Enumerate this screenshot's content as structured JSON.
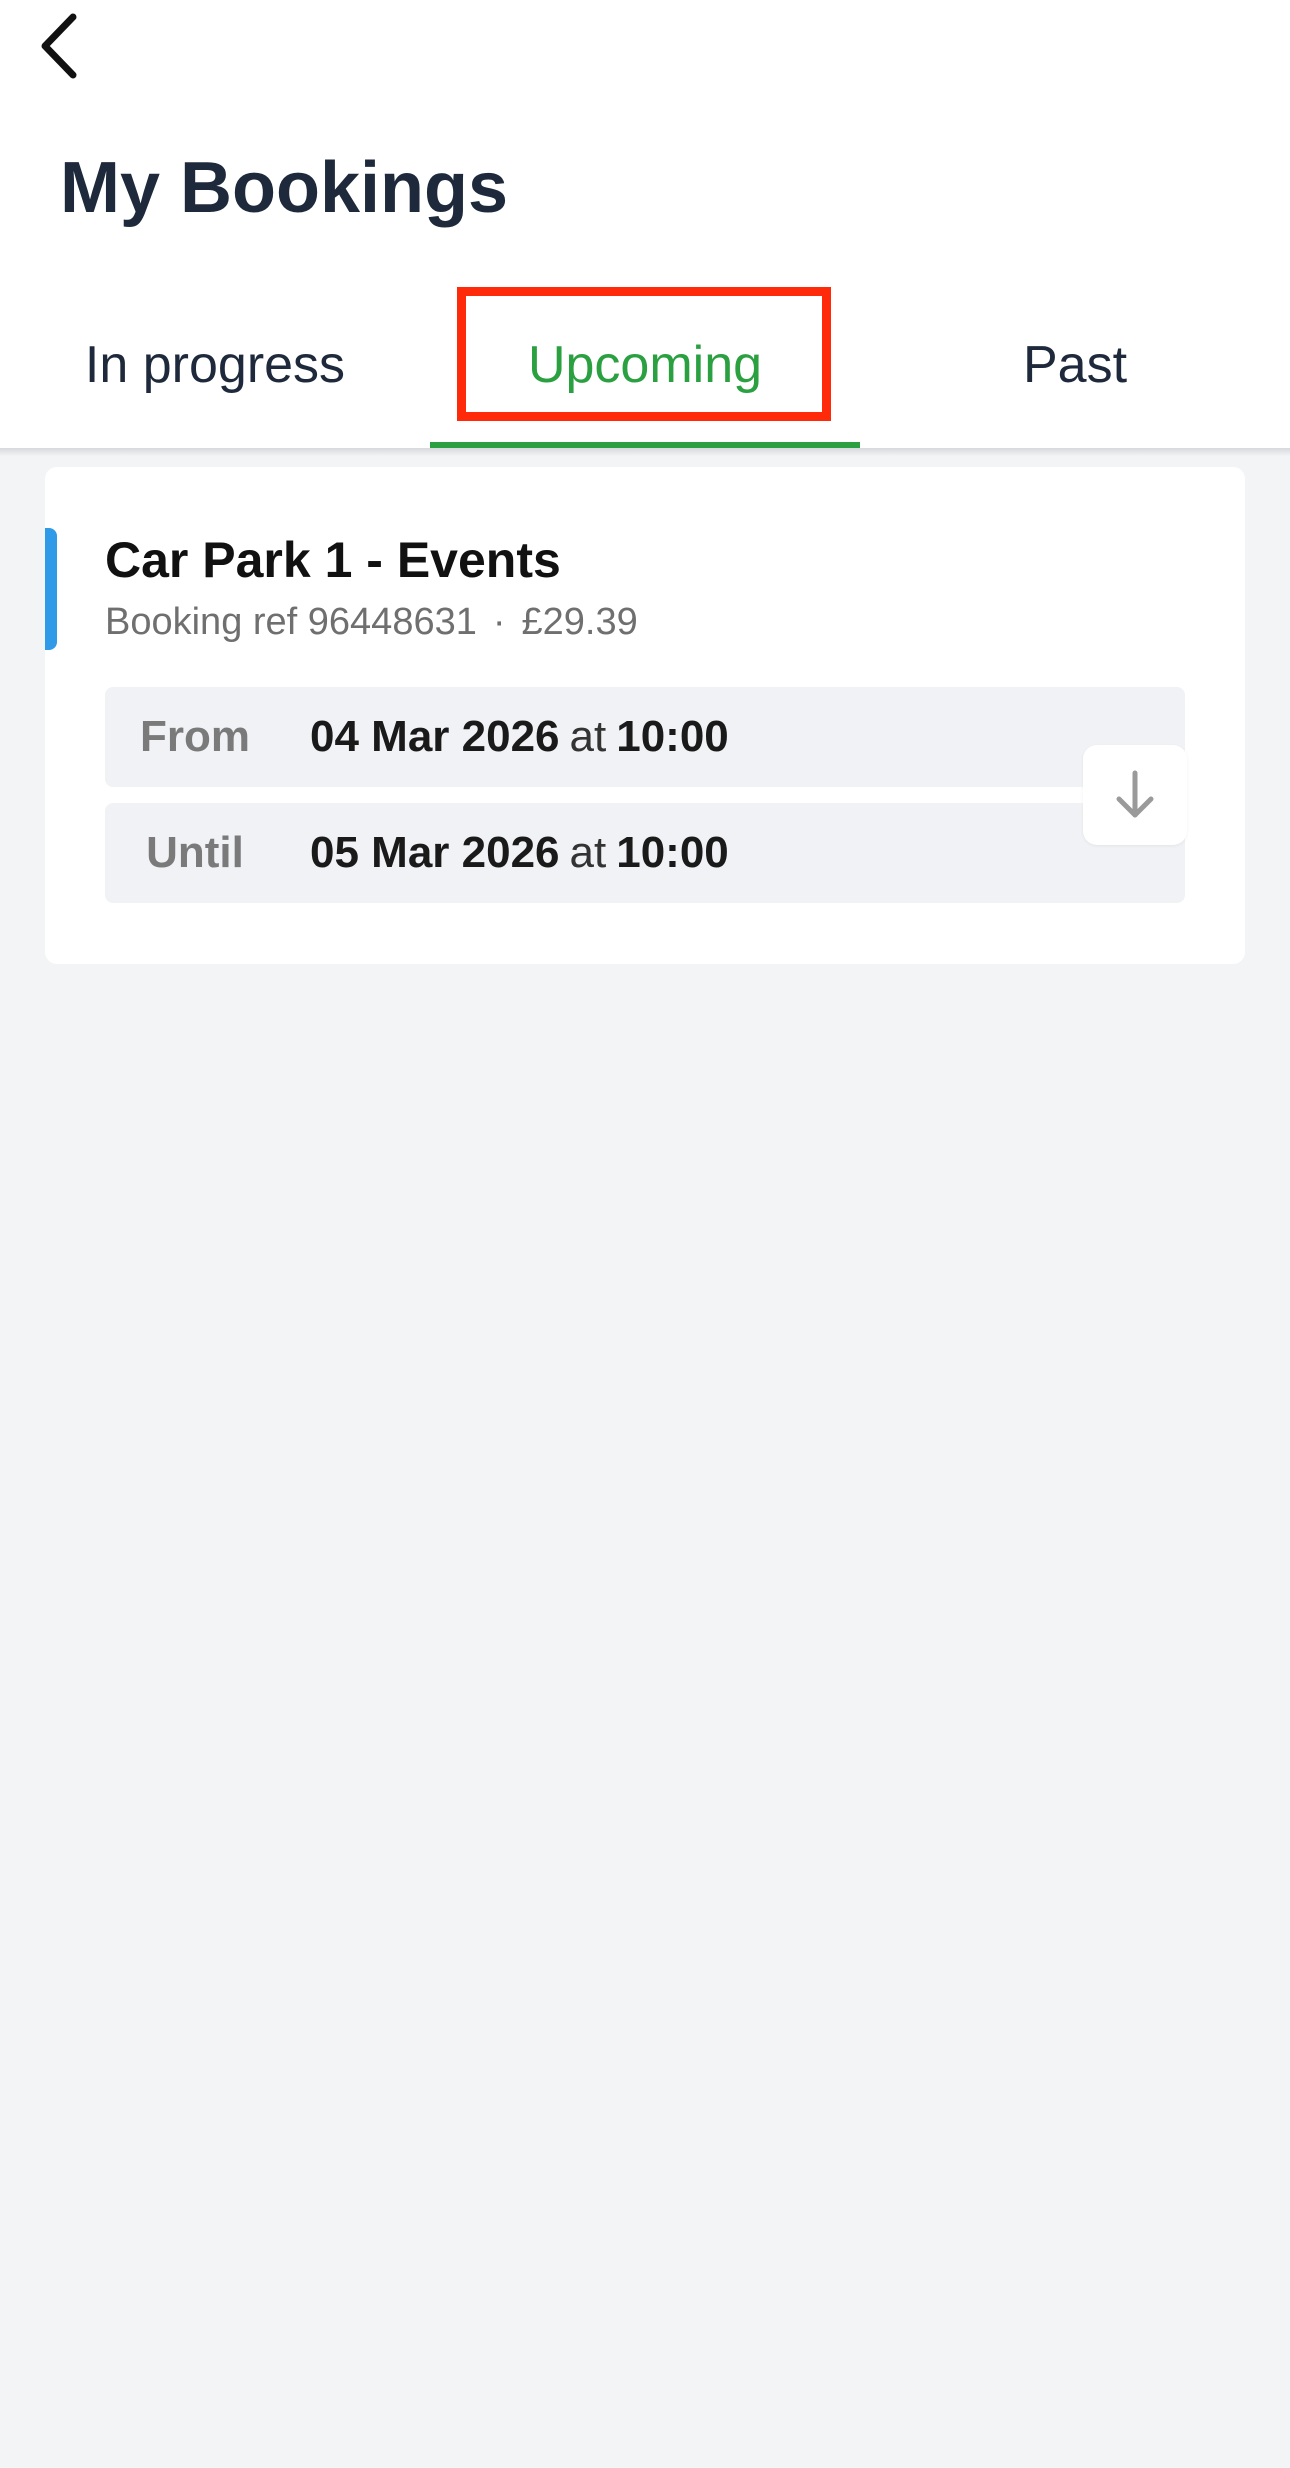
{
  "header": {
    "back_icon": "chevron-left-icon",
    "title": "My Bookings"
  },
  "tabs": [
    {
      "label": "In progress",
      "selected": false
    },
    {
      "label": "Upcoming",
      "selected": true
    },
    {
      "label": "Past",
      "selected": false
    }
  ],
  "colors": {
    "accent_green": "#2aa040",
    "highlight_red": "#ff2a0a",
    "card_accent_blue": "#2f9be8",
    "background": "#f3f4f6"
  },
  "booking": {
    "title": "Car Park 1 - Events",
    "ref": "Booking ref 96448631",
    "separator": "·",
    "price": "£29.39",
    "from": {
      "label": "From",
      "date": "04 Mar 2026",
      "at": "at",
      "time": "10:00"
    },
    "until": {
      "label": "Until",
      "date": "05 Mar 2026",
      "at": "at",
      "time": "10:00"
    },
    "download_icon": "arrow-down-icon"
  }
}
